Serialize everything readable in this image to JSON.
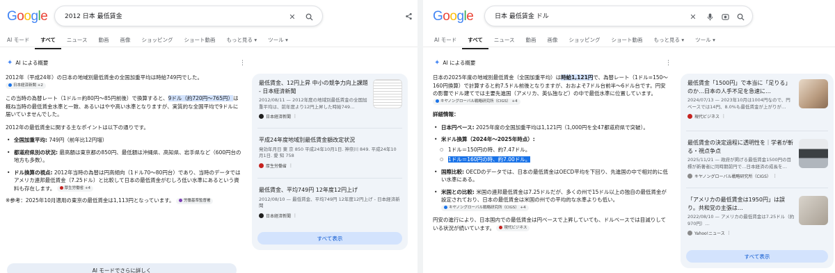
{
  "left": {
    "logo": "Google",
    "query": "2012 日本 最低賃金",
    "tabs": [
      "AI モード",
      "すべて",
      "ニュース",
      "動画",
      "画像",
      "ショッピング",
      "ショート動画",
      "もっと見る ▾",
      "ツール ▾"
    ],
    "ai_label": "AI による概要",
    "paragraph1": "2012年（平成24年）の日本の地域別最低賃金の全国加重平均は時給749円でした。",
    "p1_chip": "日本経済新聞 +2",
    "paragraph2_a": "この当時の為替レート（1ドル＝約80円〜85円前後）で換算すると、",
    "paragraph2_hl": "9ドル（約720円〜765円）",
    "paragraph2_b": "は概ね当時の最低賃金水準と一致、あるいはやや高い水準となりますが、実質的な全国平均で9ドルに届いていませんでした。",
    "paragraph3": "2012年の最低賃金に関する主なポイントは以下の通りです。",
    "bullets": [
      {
        "label": "全国加重平均:",
        "text": " 749円（前年比12円増）"
      },
      {
        "label": "都道府県別の状況:",
        "text": " 最高額は東京都の850円、最低額は沖縄県、高知県、岩手県など（600円台の地方も多数）。"
      },
      {
        "label": "ドル換算の視点:",
        "text": " 2012年当時の為替は円高傾向（1ドル70〜80円台）であり、当時のデータではアメリカ連邦最低賃金（7.25ドル）と比較して日本の最低賃金がむしろ低い水準にあるという資料も存在します。",
        "chip": "厚生労働省 +4"
      }
    ],
    "footnote": "※参考：2025年10月適用の東京の最低賃金は1,113円となっています。",
    "foot_chip": "労働基準監督署",
    "more_ai": "AI モードでさらに詳しく",
    "cards": [
      {
        "title": "最低賃金、12円上昇 中小の競争力向上課題 - 日本経済新聞",
        "snippet": "2012/08/11 — 2012年度の地域別最低賃金の全国加重平均は、前年度より12円上昇した時給749…",
        "source": "日本経済新聞"
      },
      {
        "title": "平成24年度地域別最低賃金額改定状況",
        "snippet": "発効年月日 東 京 850 平成24年10月1日. 神奈川 849. 平成24年10月1日. 愛 知 758",
        "source": "厚生労働省"
      },
      {
        "title": "最低賃金、平均749円 12年度12円上げ",
        "snippet": "2012/08/10 — 最低賃金、平均749円 12年度12円上げ - 日本経済新聞",
        "source": "日本経済新聞"
      }
    ],
    "show_all": "すべて表示"
  },
  "right": {
    "logo": "Google",
    "query": "日本 最低賃金 ドル",
    "tabs": [
      "AI モード",
      "すべて",
      "ニュース",
      "動画",
      "画像",
      "ショッピング",
      "ショート動画",
      "もっと見る ▾",
      "ツール ▾"
    ],
    "ai_label": "AI による概要",
    "paragraph1_a": "日本の2025年度の地域別最低賃金（全国加重平均）は",
    "paragraph1_hl": "時給1,121円",
    "paragraph1_b": "で、為替レート（1ドル=150〜160円換算）で計算すると約7.5ドル前後となりますが、おおよそ7ドル台前半〜6ドル台です。円安の影響でドル建てでは主要先進国（アメリカ、英仏独など）の中で最低水準に位置しています。",
    "p1_chip": "キヤノングローバル戦略研究所（CIGS） +4",
    "detail_label": "詳細情報：",
    "bullets": [
      {
        "label": "日本円ベース:",
        "text": " 2025年度の全国加重平均は1,121円（1,000円を全47都道府県で突破）。"
      },
      {
        "label": "米ドル換算（2024年〜2025年時点）:",
        "text": ""
      }
    ],
    "sub_bullets": [
      "1ドル＝150円の時、約7.47ドル。",
      "1ドル＝160円の時、約7.00ドル。"
    ],
    "bullets2": [
      {
        "label": "国際比較:",
        "text": " OECDのデータでは、日本の最低賃金はOECD平均を下回り、先進国の中で相対的に低い水準にある。"
      },
      {
        "label": "米国との比較:",
        "text": " 米国の連邦最低賃金は7.25ドルだが、多くの州で15ドル以上の独自の最低賃金が設定されており、日本の最低賃金は米国の州での平均的な水準よりも低い。",
        "chip": "キヤノングローバル戦略研究所（CIGS） +4"
      }
    ],
    "closing": "円安の進行により、日本国内での最低賃金は円ベースで上昇していても、ドルベースでは目減りしている状況が続いています。",
    "closing_chip": "現代ビジネス",
    "cards": [
      {
        "title": "最低賃金「1500円」で本当に「足りる」のか…日本の人手不足を急速に…",
        "snippet": "2024/07/13 — 2023年10月は1004円なので、円ベースでは14円、8.0%も最低賃金が上がりが…",
        "source": "現代ビジネス"
      },
      {
        "title": "最低賃金の決定過程に透明性を｜学者が斬る・視点争点",
        "snippet": "2025/11/21 — 政府が掲げる最低賃金1500円の目標が新著者に同時期前円で…日本経済の成長を…",
        "source": "キヤノングローバル戦略研究所（CIGS）"
      },
      {
        "title": "「アメリカの最低賃金は1950円」は誤り。共和党の主張は…",
        "snippet": "2022/08/10 — アメリカの最低賃金は7.25ドル（約970円）…",
        "source": "Yahoo!ニュース"
      }
    ],
    "show_all": "すべて表示"
  }
}
